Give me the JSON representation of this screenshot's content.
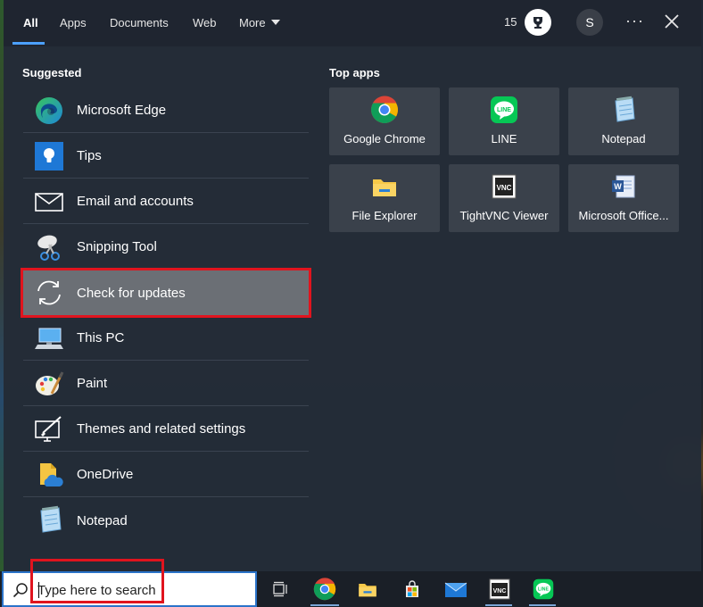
{
  "nav": {
    "tabs": [
      "All",
      "Apps",
      "Documents",
      "Web",
      "More"
    ],
    "points": "15",
    "avatar_initial": "S",
    "more_options": "···"
  },
  "suggested": {
    "title": "Suggested",
    "items": [
      {
        "label": "Microsoft Edge",
        "icon": "edge-icon"
      },
      {
        "label": "Tips",
        "icon": "tips-icon"
      },
      {
        "label": "Email and accounts",
        "icon": "mail-icon"
      },
      {
        "label": "Snipping Tool",
        "icon": "snipping-tool-icon"
      },
      {
        "label": "Check for updates",
        "icon": "sync-icon"
      },
      {
        "label": "This PC",
        "icon": "computer-icon"
      },
      {
        "label": "Paint",
        "icon": "paint-icon"
      },
      {
        "label": "Themes and related settings",
        "icon": "themes-icon"
      },
      {
        "label": "OneDrive",
        "icon": "onedrive-icon"
      },
      {
        "label": "Notepad",
        "icon": "notepad-icon"
      }
    ]
  },
  "top_apps": {
    "title": "Top apps",
    "items": [
      {
        "label": "Google Chrome",
        "icon": "chrome-icon"
      },
      {
        "label": "LINE",
        "icon": "line-icon"
      },
      {
        "label": "Notepad",
        "icon": "notepad-icon"
      },
      {
        "label": "File Explorer",
        "icon": "file-explorer-icon"
      },
      {
        "label": "TightVNC Viewer",
        "icon": "tightvnc-icon"
      },
      {
        "label": "Microsoft Office...",
        "icon": "word-icon"
      }
    ]
  },
  "taskbar": {
    "search_placeholder": "Type here to search",
    "vnc_text": "VNC"
  },
  "colors": {
    "accent": "#4ca0ff",
    "highlight_outline": "#e0141e",
    "panel_bg": "#242c38"
  }
}
